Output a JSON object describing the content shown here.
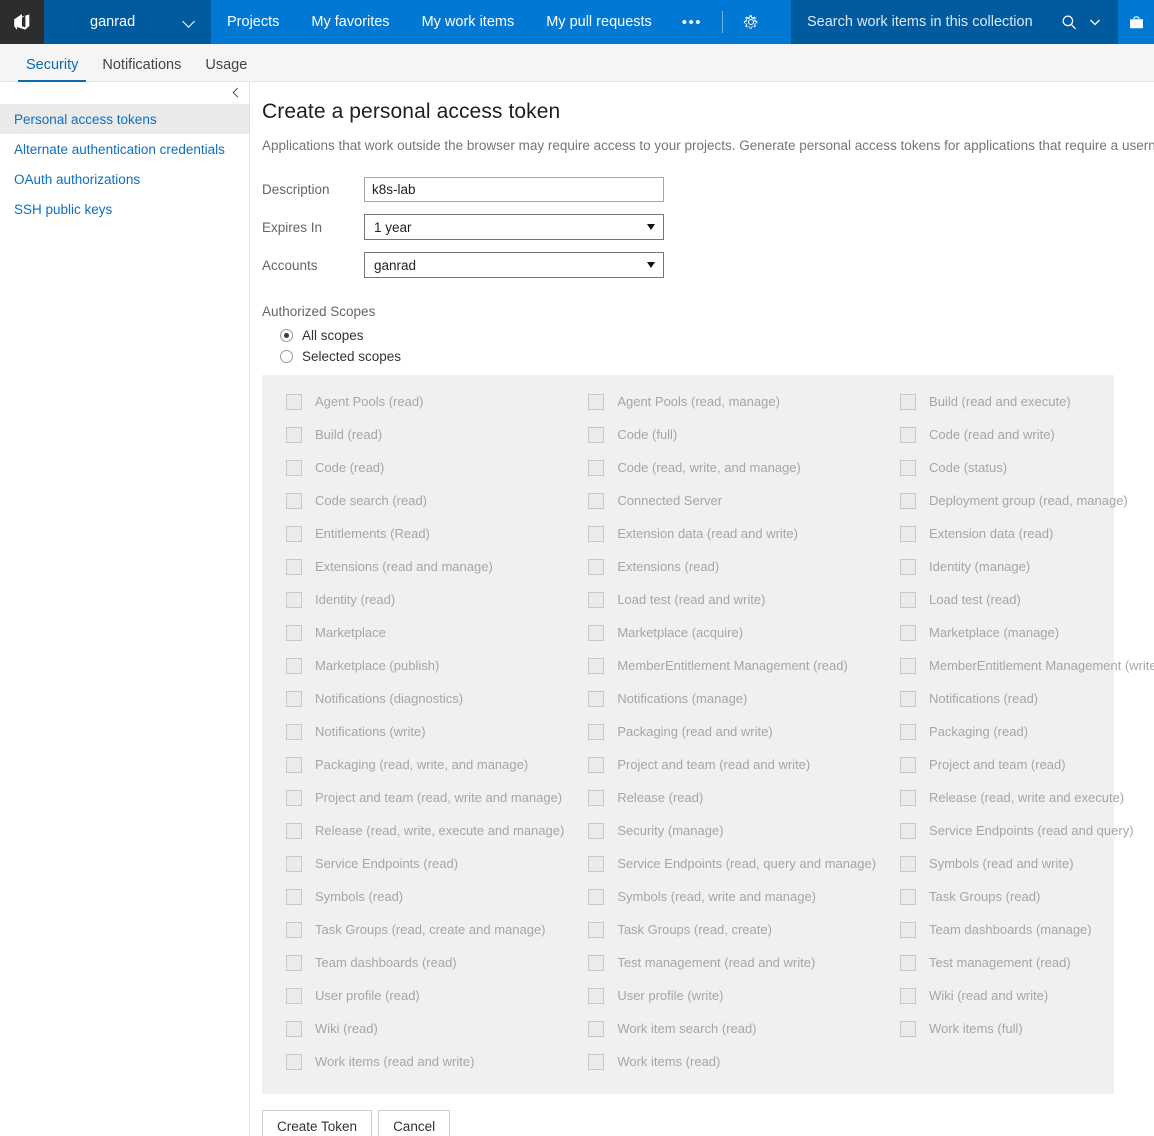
{
  "header": {
    "logo_icon": "azure-devops-logo",
    "organization": "ganrad",
    "nav": [
      {
        "label": "Projects"
      },
      {
        "label": "My favorites"
      },
      {
        "label": "My work items"
      },
      {
        "label": "My pull requests"
      }
    ],
    "overflow_label": "•••",
    "settings_icon": "gear-icon",
    "search_placeholder": "Search work items in this collection",
    "search_icon": "search-icon",
    "search_chevron_icon": "chevron-down-icon",
    "marketplace_icon": "marketplace-bag-icon"
  },
  "tabs": [
    {
      "label": "Security",
      "active": true
    },
    {
      "label": "Notifications",
      "active": false
    },
    {
      "label": "Usage",
      "active": false
    }
  ],
  "sidebar": {
    "collapse_icon": "chevron-left-icon",
    "items": [
      {
        "label": "Personal access tokens",
        "selected": true
      },
      {
        "label": "Alternate authentication credentials",
        "selected": false
      },
      {
        "label": "OAuth authorizations",
        "selected": false
      },
      {
        "label": "SSH public keys",
        "selected": false
      }
    ]
  },
  "main": {
    "title": "Create a personal access token",
    "description": "Applications that work outside the browser may require access to your projects. Generate personal access tokens for applications that require a username and password.",
    "fields": {
      "description": {
        "label": "Description",
        "value": "k8s-lab",
        "placeholder": ""
      },
      "expires_in": {
        "label": "Expires In",
        "value": "1 year"
      },
      "accounts": {
        "label": "Accounts",
        "value": "ganrad"
      }
    },
    "scopes_heading": "Authorized Scopes",
    "scope_mode": [
      {
        "label": "All scopes",
        "checked": true
      },
      {
        "label": "Selected scopes",
        "checked": false
      }
    ],
    "scope_columns": [
      [
        "Agent Pools (read)",
        "Build (read)",
        "Code (read)",
        "Code search (read)",
        "Entitlements (Read)",
        "Extensions (read and manage)",
        "Identity (read)",
        "Marketplace",
        "Marketplace (publish)",
        "Notifications (diagnostics)",
        "Notifications (write)",
        "Packaging (read, write, and manage)",
        "Project and team (read, write and manage)",
        "Release (read, write, execute and manage)",
        "Service Endpoints (read)",
        "Symbols (read)",
        "Task Groups (read, create and manage)",
        "Team dashboards (read)",
        "User profile (read)",
        "Wiki (read)",
        "Work items (read and write)"
      ],
      [
        "Agent Pools (read, manage)",
        "Code (full)",
        "Code (read, write, and manage)",
        "Connected Server",
        "Extension data (read and write)",
        "Extensions (read)",
        "Load test (read and write)",
        "Marketplace (acquire)",
        "MemberEntitlement Management (read)",
        "Notifications (manage)",
        "Packaging (read and write)",
        "Project and team (read and write)",
        "Release (read)",
        "Security (manage)",
        "Service Endpoints (read, query and manage)",
        "Symbols (read, write and manage)",
        "Task Groups (read, create)",
        "Test management (read and write)",
        "User profile (write)",
        "Work item search (read)",
        "Work items (read)"
      ],
      [
        "Build (read and execute)",
        "Code (read and write)",
        "Code (status)",
        "Deployment group (read, manage)",
        "Extension data (read)",
        "Identity (manage)",
        "Load test (read)",
        "Marketplace (manage)",
        "MemberEntitlement Management (write)",
        "Notifications (read)",
        "Packaging (read)",
        "Project and team (read)",
        "Release (read, write and execute)",
        "Service Endpoints (read and query)",
        "Symbols (read and write)",
        "Task Groups (read)",
        "Team dashboards (manage)",
        "Test management (read)",
        "Wiki (read and write)",
        "Work items (full)"
      ]
    ],
    "buttons": {
      "create": "Create Token",
      "cancel": "Cancel"
    }
  },
  "colors": {
    "brand_blue": "#0078d4",
    "dark_blue": "#005a9e",
    "logo_bg": "#2d2d30",
    "link_blue": "#106ebe",
    "panel_gray": "#f0f0f0"
  }
}
